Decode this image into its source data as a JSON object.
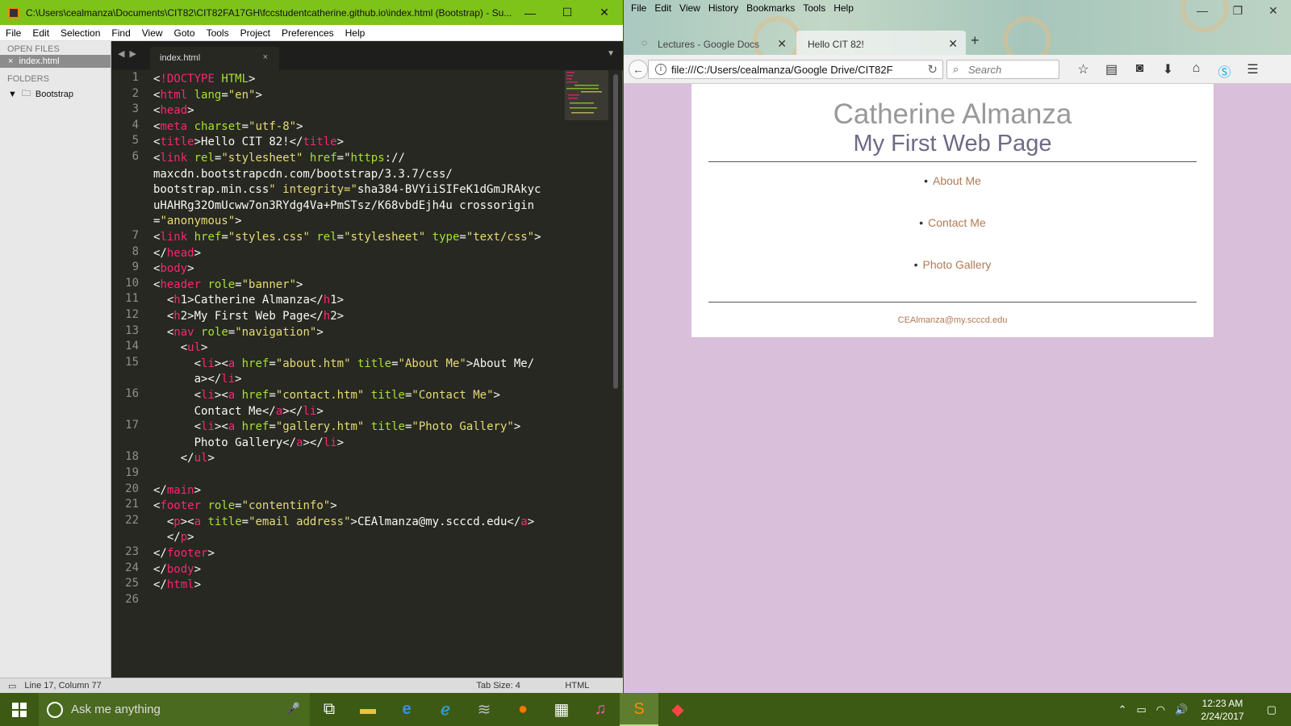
{
  "sublime": {
    "title": "C:\\Users\\cealmanza\\Documents\\CIT82\\CIT82FA17GH\\fccstudentcatherine.github.io\\index.html (Bootstrap) - Su...",
    "menu": [
      "File",
      "Edit",
      "Selection",
      "Find",
      "View",
      "Goto",
      "Tools",
      "Project",
      "Preferences",
      "Help"
    ],
    "sidebar": {
      "open_files_label": "OPEN FILES",
      "open_file": "index.html",
      "folders_label": "FOLDERS",
      "folder": "Bootstrap"
    },
    "tab": {
      "name": "index.html"
    },
    "line_numbers": [
      "1",
      "2",
      "3",
      "4",
      "5",
      "6",
      "",
      "",
      "",
      "",
      "7",
      "8",
      "9",
      "10",
      "11",
      "12",
      "13",
      "14",
      "15",
      "",
      "16",
      "",
      "17",
      "",
      "18",
      "19",
      "20",
      "21",
      "22",
      "",
      "23",
      "24",
      "25",
      "26"
    ],
    "code_lines": [
      "<!DOCTYPE HTML>",
      "<html lang=\"en\">",
      "<head>",
      "<meta charset=\"utf-8\">",
      "<title>Hello CIT 82!</title>",
      "<link rel=\"stylesheet\" href=\"https://",
      "maxcdn.bootstrapcdn.com/bootstrap/3.3.7/css/",
      "bootstrap.min.css\" integrity=\"sha384-BVYiiSIFeK1dGmJRAkyc",
      "uHAHRg32OmUcww7on3RYdg4Va+PmSTsz/K68vbdEjh4u\" crossorigin",
      "=\"anonymous\">",
      "<link href=\"styles.css\" rel=\"stylesheet\" type=\"text/css\">",
      "</head>",
      "<body>",
      "<header role=\"banner\">",
      "  <h1>Catherine Almanza</h1>",
      "  <h2>My First Web Page</h2>",
      "  <nav role=\"navigation\">",
      "    <ul>",
      "      <li><a href=\"about.htm\" title=\"About Me\">About Me</",
      "      a></li>",
      "      <li><a href=\"contact.htm\" title=\"Contact Me\">",
      "      Contact Me</a></li>",
      "      <li><a href=\"gallery.htm\" title=\"Photo Gallery\">",
      "      Photo Gallery</a></li>",
      "    </ul>",
      "",
      "</main>",
      "<footer role=\"contentinfo\">",
      "  <p><a title=\"email address\">CEAlmanza@my.scccd.edu</a>",
      "  </p>",
      "</footer>",
      "</body>",
      "</html>",
      ""
    ],
    "status": {
      "position": "Line 17, Column 77",
      "tab_size": "Tab Size: 4",
      "syntax": "HTML"
    }
  },
  "firefox": {
    "menu": [
      "File",
      "Edit",
      "View",
      "History",
      "Bookmarks",
      "Tools",
      "Help"
    ],
    "tabs": [
      {
        "label": "Lectures - Google Docs"
      },
      {
        "label": "Hello CIT 82!"
      }
    ],
    "url": "file:///C:/Users/cealmanza/Google Drive/CIT82F",
    "search_placeholder": "Search",
    "page": {
      "h1": "Catherine Almanza",
      "h2": "My First Web Page",
      "nav": [
        "About Me",
        "Contact Me",
        "Photo Gallery"
      ],
      "footer_email": "CEAlmanza@my.scccd.edu"
    }
  },
  "taskbar": {
    "search_placeholder": "Ask me anything",
    "time": "12:23 AM",
    "date": "2/24/2017"
  },
  "colors": {
    "sublime_title": "#7ec31a",
    "editor_bg": "#272822",
    "page_bg": "#d9bfda",
    "taskbar": "#3c5a14",
    "link": "#b07a55"
  }
}
